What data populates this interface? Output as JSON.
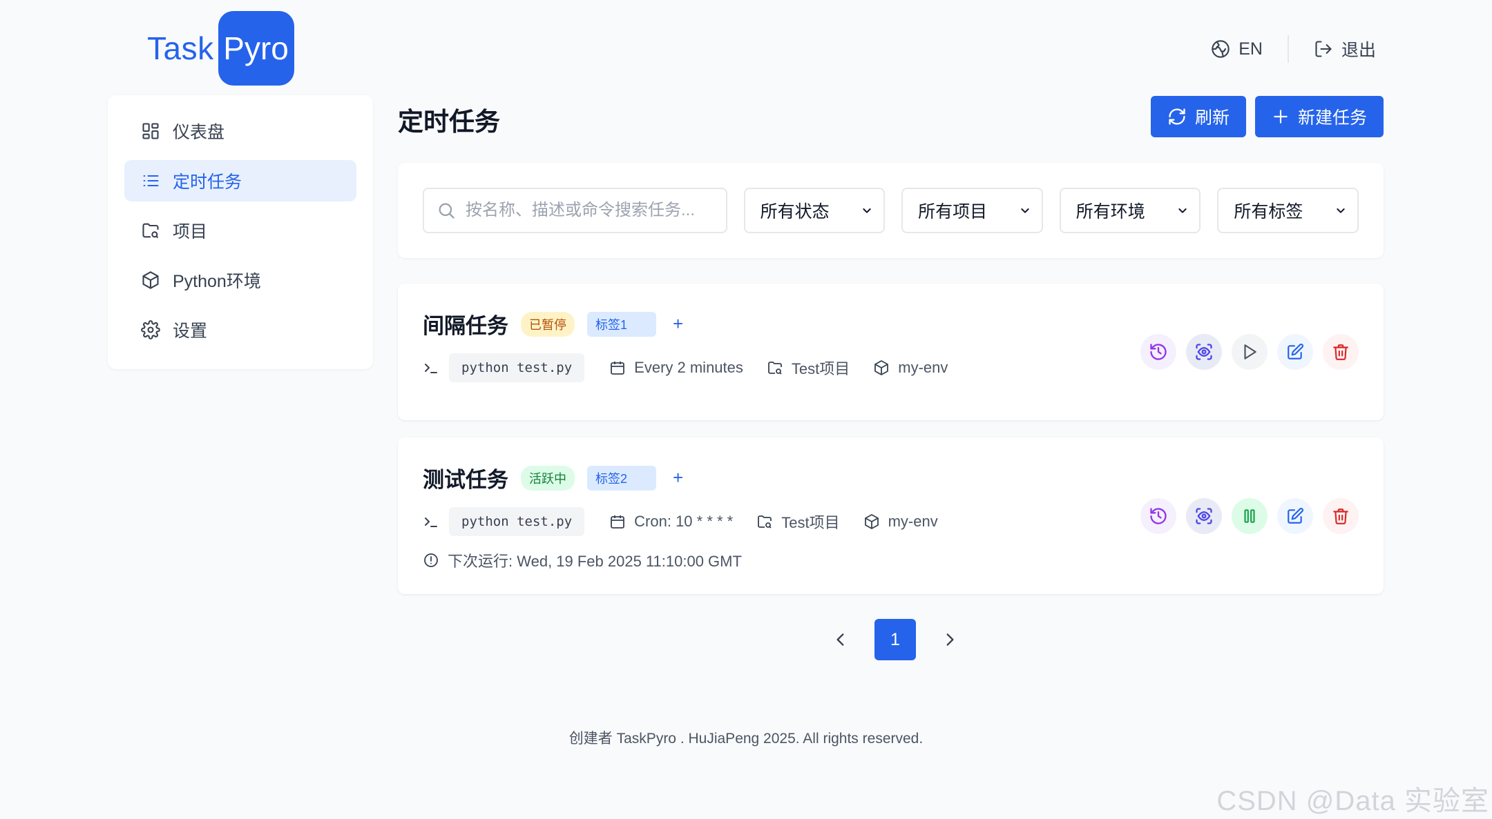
{
  "logo": {
    "part1": "Task",
    "part2": "Pyro"
  },
  "header": {
    "lang_label": "EN",
    "logout_label": "退出"
  },
  "sidebar": {
    "items": [
      {
        "label": "仪表盘",
        "icon": "dashboard-icon"
      },
      {
        "label": "定时任务",
        "icon": "list-icon",
        "active": true
      },
      {
        "label": "项目",
        "icon": "folder-icon"
      },
      {
        "label": "Python环境",
        "icon": "cube-icon"
      },
      {
        "label": "设置",
        "icon": "gear-icon"
      }
    ]
  },
  "main": {
    "title": "定时任务",
    "refresh_label": "刷新",
    "new_task_label": "新建任务",
    "search": {
      "placeholder": "按名称、描述或命令搜索任务..."
    },
    "filters": {
      "status": "所有状态",
      "project": "所有项目",
      "env": "所有环境",
      "tags": "所有标签"
    }
  },
  "tasks": [
    {
      "name": "间隔任务",
      "status": "已暂停",
      "tag": "标签1",
      "add_tag": "+",
      "command": "python test.py",
      "schedule": "Every 2 minutes",
      "project": "Test项目",
      "env": "my-env"
    },
    {
      "name": "测试任务",
      "status": "活跃中",
      "tag": "标签2",
      "add_tag": "+",
      "command": "python test.py",
      "schedule": "Cron: 10 * * * *",
      "project": "Test项目",
      "env": "my-env",
      "next_run": "下次运行: Wed, 19 Feb 2025 11:10:00 GMT"
    }
  ],
  "pagination": {
    "current": "1"
  },
  "footer": "创建者 TaskPyro . HuJiaPeng 2025. All rights reserved.",
  "watermark": "CSDN @Data 实验室",
  "colors": {
    "primary": "#2563eb",
    "paused": "#b45309",
    "active": "#15803d",
    "danger": "#dc2626",
    "purple": "#9333ea"
  }
}
